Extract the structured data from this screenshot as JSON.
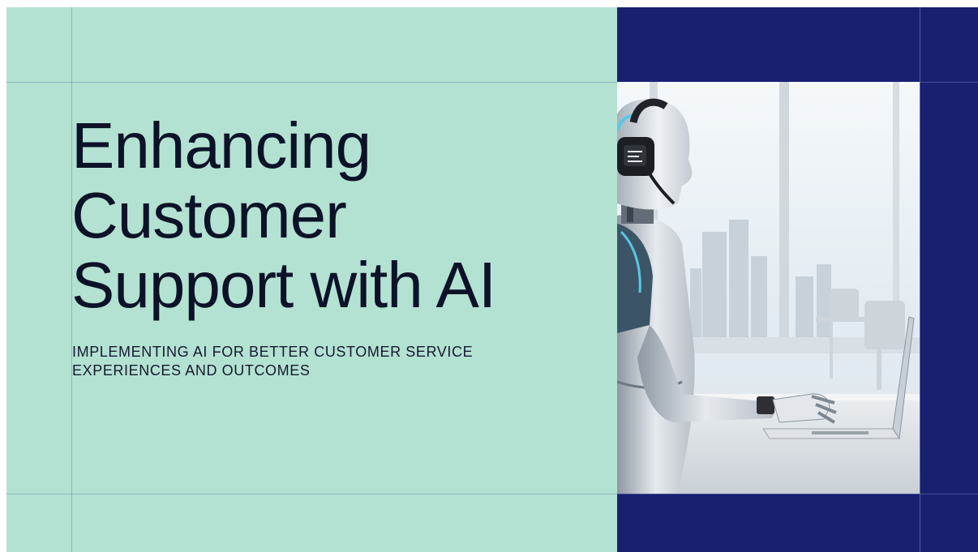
{
  "slide": {
    "title_lines": [
      "Enhancing",
      "Customer",
      "Support with AI"
    ],
    "subtitle_lines": [
      "IMPLEMENTING AI FOR BETTER CUSTOMER SERVICE",
      "EXPERIENCES AND OUTCOMES"
    ],
    "colors": {
      "background": "#b4e2d2",
      "navy_panel": "#1a2070",
      "title_text": "#0c1228",
      "subtitle_text": "#15192e"
    }
  },
  "image": {
    "subject": "humanoid-robot-with-headset-typing-on-laptop-icon"
  }
}
